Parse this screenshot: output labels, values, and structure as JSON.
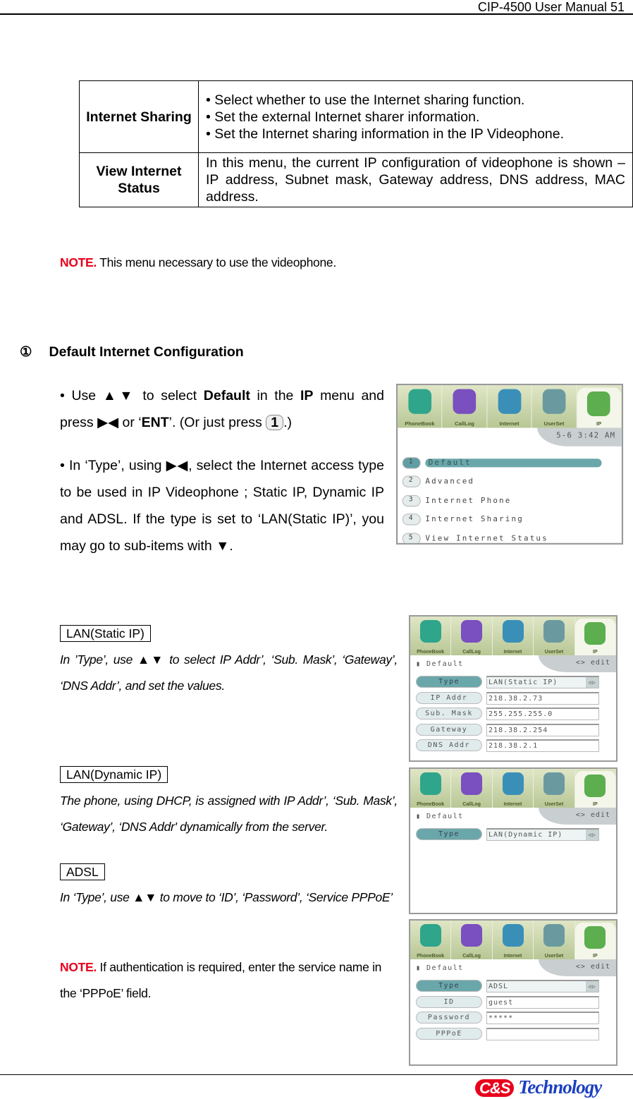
{
  "header": {
    "title": "CIP-4500 User Manual 51"
  },
  "table": [
    {
      "key": "Internet Sharing",
      "lines": [
        "• Select whether to use the Internet sharing function.",
        "• Set the external Internet sharer information.",
        "• Set the Internet sharing information in the IP Videophone."
      ]
    },
    {
      "key": "View Internet Status",
      "lines": [
        "In this menu, the current IP configuration of videophone is shown – IP address, Subnet mask, Gateway address, DNS address, MAC address."
      ]
    }
  ],
  "note1": {
    "label": "NOTE.",
    "text": " This menu necessary to use the videophone."
  },
  "section": {
    "number": "①",
    "title": "Default Internet Configuration"
  },
  "para1": {
    "a": "• Use ▲▼ to select ",
    "b": "Default",
    "c": " in the ",
    "d": "IP",
    "e": " menu and press ▶◀ or ‘",
    "f": "ENT",
    "g": "’. (Or just press ",
    "key": "1",
    "h": ".)"
  },
  "para2": "• In ‘Type’, using ▶◀, select the Internet access type to be used in IP Videophone ; Static IP, Dynamic IP and ADSL. If the type is set to ‘LAN(Static IP)’, you may go to sub-items with ▼.",
  "static": {
    "label": "LAN(Static IP)",
    "text": "In ’Type’, use ▲▼ to select IP Addr’, ‘Sub. Mask’, ‘Gateway’, ‘DNS Addr’, and set the values."
  },
  "dynamic": {
    "label": "LAN(Dynamic IP)",
    "text": "The phone, using DHCP, is assigned with IP Addr’, ‘Sub. Mask’, ‘Gateway’, ‘DNS Addr' dynamically from the server."
  },
  "adsl": {
    "label": "ADSL",
    "text": "In ‘Type’, use ▲▼ to move to ‘ID’, ‘Password’, ‘Service PPPoE’"
  },
  "note2": {
    "label": "NOTE.",
    "text": " If authentication is required, enter the service name in the ‘PPPoE’ field."
  },
  "tabs": [
    "PhoneBook",
    "CallLog",
    "Internet",
    "UserSet",
    "IP"
  ],
  "tab_colors": [
    "#2fa58c",
    "#7a4fc0",
    "#3a8fb8",
    "#6a9aa0",
    "#5cae4e"
  ],
  "screens": [
    {
      "strip": "5-6  3:42 AM",
      "menu": [
        {
          "n": "1",
          "label": "Default",
          "selected": true
        },
        {
          "n": "2",
          "label": "Advanced"
        },
        {
          "n": "3",
          "label": "Internet Phone"
        },
        {
          "n": "4",
          "label": "Internet Sharing"
        },
        {
          "n": "5",
          "label": "View Internet Status"
        }
      ]
    },
    {
      "strip": "<> edit",
      "title": "Default",
      "fields": [
        {
          "label": "Type",
          "value": "LAN(Static IP)",
          "selected": true
        },
        {
          "label": "IP Addr",
          "value": "218.38.2.73"
        },
        {
          "label": "Sub. Mask",
          "value": "255.255.255.0"
        },
        {
          "label": "Gateway",
          "value": "218.38.2.254"
        },
        {
          "label": "DNS Addr",
          "value": "218.38.2.1"
        }
      ]
    },
    {
      "strip": "<> edit",
      "title": "Default",
      "fields": [
        {
          "label": "Type",
          "value": "LAN(Dynamic IP)",
          "selected": true
        }
      ]
    },
    {
      "strip": "<> edit",
      "title": "Default",
      "fields": [
        {
          "label": "Type",
          "value": "ADSL",
          "selected": true
        },
        {
          "label": "ID",
          "value": "guest"
        },
        {
          "label": "Password",
          "value": "*****"
        },
        {
          "label": "PPPoE",
          "value": ""
        }
      ]
    }
  ],
  "footer": {
    "logo": "C&S Technology"
  }
}
